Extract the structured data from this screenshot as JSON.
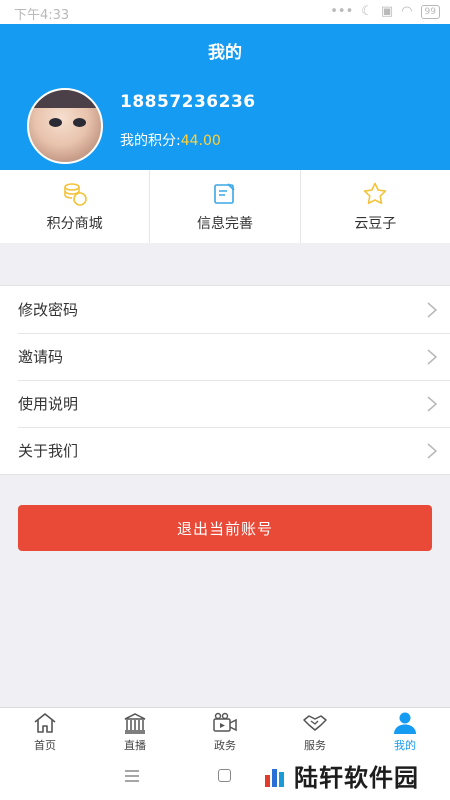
{
  "status_bar": {
    "time": "下午4:33",
    "battery": "99"
  },
  "header": {
    "title": "我的",
    "phone": "18857236236",
    "points_label": "我的积分:",
    "points_value": "44.00"
  },
  "shortcuts": [
    {
      "label": "积分商城",
      "icon": "coins-icon"
    },
    {
      "label": "信息完善",
      "icon": "edit-profile-icon"
    },
    {
      "label": "云豆子",
      "icon": "star-icon"
    }
  ],
  "menu": [
    {
      "label": "修改密码"
    },
    {
      "label": "邀请码"
    },
    {
      "label": "使用说明"
    },
    {
      "label": "关于我们"
    }
  ],
  "logout_label": "退出当前账号",
  "tabs": [
    {
      "label": "首页",
      "icon": "home-icon"
    },
    {
      "label": "直播",
      "icon": "building-icon"
    },
    {
      "label": "政务",
      "icon": "video-camera-icon"
    },
    {
      "label": "服务",
      "icon": "handshake-icon"
    },
    {
      "label": "我的",
      "icon": "user-icon",
      "active": true
    }
  ],
  "watermark": "陆轩软件园",
  "colors": {
    "primary": "#169bf2",
    "accent_points": "#ffd23c",
    "logout": "#e84a37",
    "shortcut_icons": "#f3c33b"
  }
}
